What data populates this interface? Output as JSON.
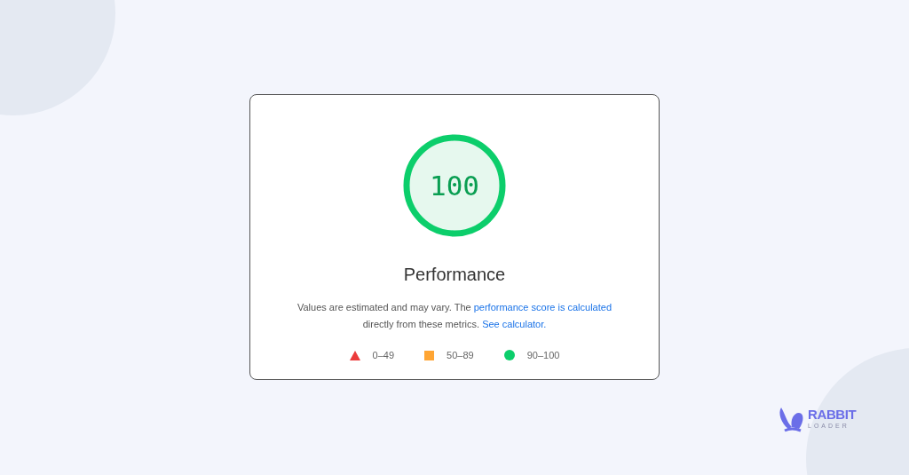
{
  "card": {
    "gauge": {
      "score": "100",
      "level": 1,
      "color": "#0cce6b"
    },
    "title": "Performance",
    "description": [
      {
        "kind": "text",
        "text": "Values are estimated and may vary. The "
      },
      {
        "kind": "link",
        "text": "performance score is calculated"
      },
      {
        "kind": "text",
        "text": " directly from these metrics. "
      },
      {
        "kind": "link",
        "text": "See calculator."
      }
    ],
    "legend": [
      {
        "kind": "triangle",
        "color": "#eb3b3b",
        "label": "0–49"
      },
      {
        "kind": "square",
        "color": "#ffa533",
        "label": "50–89"
      },
      {
        "kind": "circle",
        "color": "#0cce6b",
        "label": "90–100"
      }
    ]
  },
  "logo": {
    "name": "RABBIT",
    "tagline": "LOADER"
  }
}
